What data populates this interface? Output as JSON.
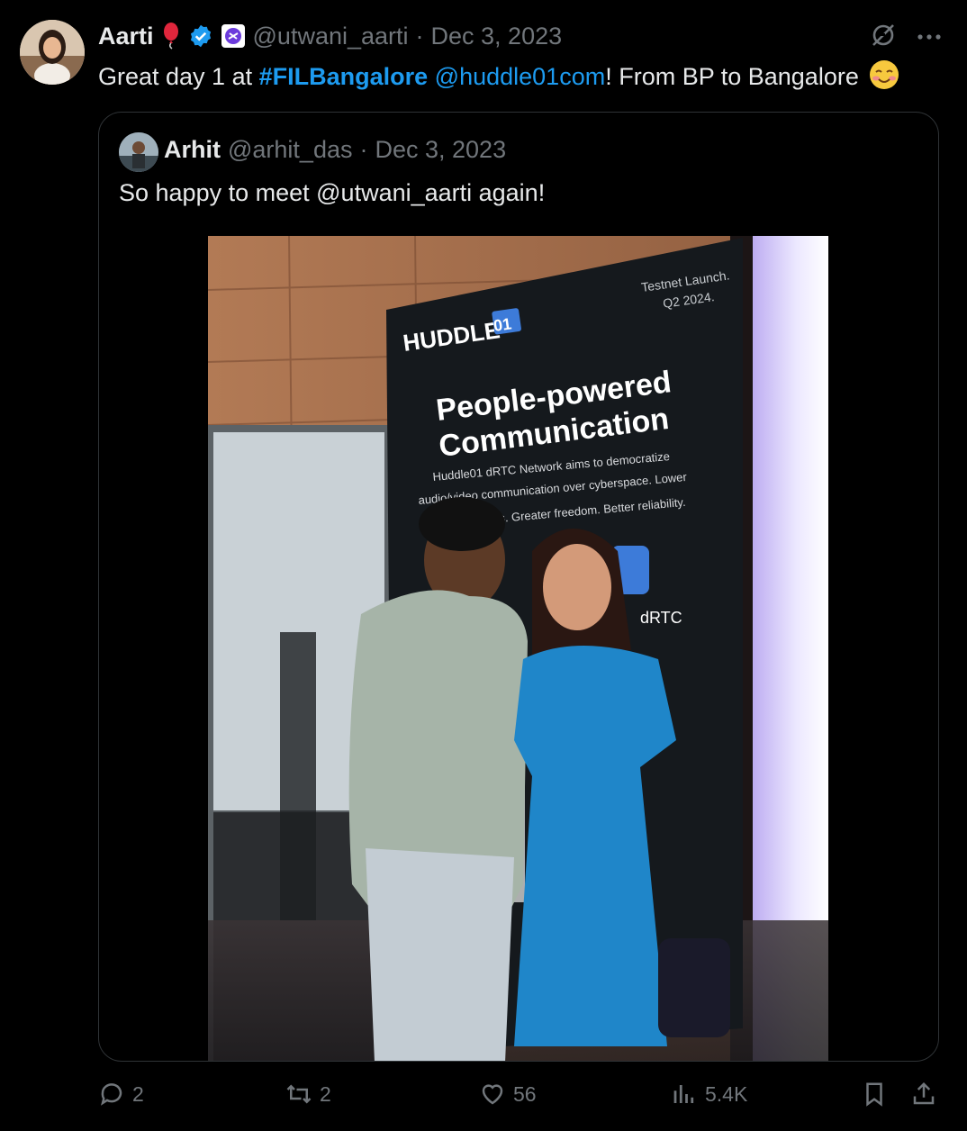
{
  "tweet": {
    "author_name": "Aarti",
    "handle": "@utwani_aarti",
    "separator": "·",
    "date": "Dec 3, 2023",
    "text_prefix": "Great day 1 at ",
    "hashtag": "#FILBangalore",
    "space": " ",
    "mention": "@huddle01com",
    "text_suffix": "! From BP to Bangalore",
    "emoji": "☺️"
  },
  "quote": {
    "author_name": "Arhit",
    "handle": "@arhit_das",
    "separator": "·",
    "date": "Dec 3, 2023",
    "text": "So happy to meet @utwani_aarti again!",
    "photo": {
      "banner_brand": "HUDDLE",
      "banner_brand_num": "01",
      "banner_corner": "Testnet Launch.",
      "banner_corner2": "Q2 2024.",
      "banner_title1": "People-powered",
      "banner_title2": "Communication",
      "banner_body1": "Huddle01 dRTC Network aims to democratize",
      "banner_body2": "audio/video communication over cyberspace. Lower",
      "banner_body3": "costs. Greater freedom. Better reliability.",
      "banner_side": "dRTC"
    }
  },
  "actions": {
    "replies": "2",
    "reposts": "2",
    "likes": "56",
    "views": "5.4K"
  },
  "colors": {
    "background": "#000000",
    "text": "#e7e9ea",
    "muted": "#71767b",
    "link": "#1d9bf0",
    "border": "#2f3336",
    "dress": "#1f86c9"
  }
}
